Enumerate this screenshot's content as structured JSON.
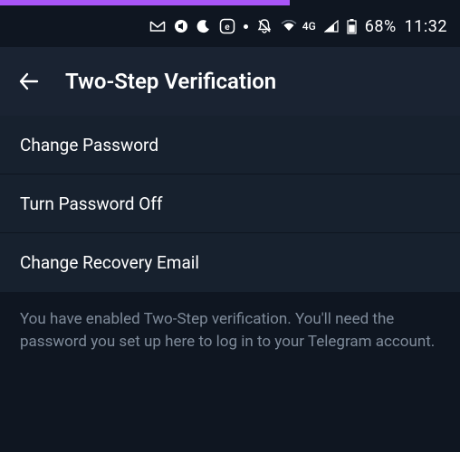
{
  "status_bar": {
    "network_label": "4G",
    "battery_text": "68%",
    "time": "11:32"
  },
  "app_bar": {
    "title": "Two-Step Verification"
  },
  "options": [
    {
      "label": "Change Password"
    },
    {
      "label": "Turn Password Off"
    },
    {
      "label": "Change Recovery Email"
    }
  ],
  "footer_text": "You have enabled Two-Step verification.\nYou'll need the password you set up here to log in to your Telegram account."
}
